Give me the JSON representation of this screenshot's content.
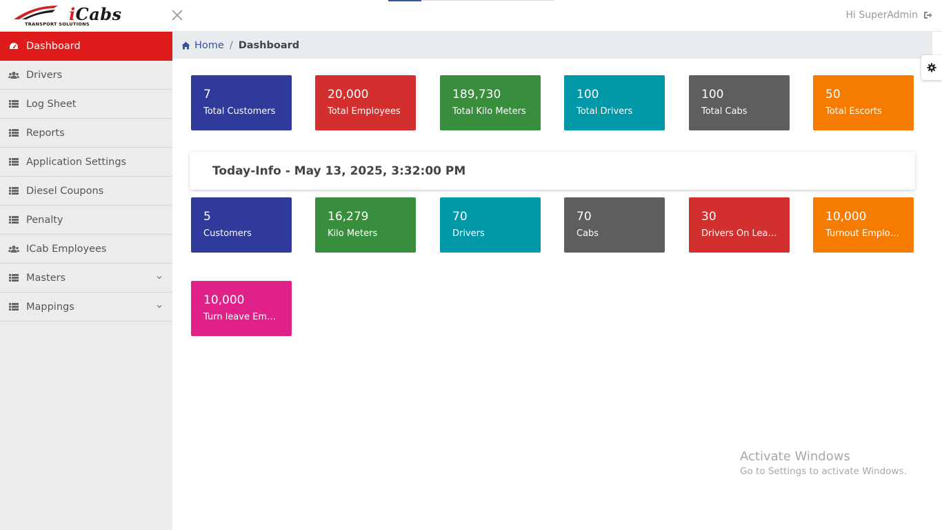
{
  "header": {
    "logo_text": "iCabs",
    "logo_tagline": "TRANSPORT SOLUTIONS",
    "greeting": "Hi SuperAdmin"
  },
  "sidebar": {
    "items": [
      {
        "label": "Dashboard",
        "icon": "dashboard-icon"
      },
      {
        "label": "Drivers",
        "icon": "users-icon"
      },
      {
        "label": "Log Sheet",
        "icon": "list-icon"
      },
      {
        "label": "Reports",
        "icon": "list-icon"
      },
      {
        "label": "Application Settings",
        "icon": "list-icon"
      },
      {
        "label": "Diesel Coupons",
        "icon": "list-icon"
      },
      {
        "label": "Penalty",
        "icon": "list-icon"
      },
      {
        "label": "ICab Employees",
        "icon": "users-icon"
      },
      {
        "label": "Masters",
        "icon": "list-icon"
      },
      {
        "label": "Mappings",
        "icon": "list-icon"
      }
    ]
  },
  "breadcrumb": {
    "home": "Home",
    "current": "Dashboard"
  },
  "totals": [
    {
      "value": "7",
      "label": "Total Customers",
      "color": "#2f3a9b"
    },
    {
      "value": "20,000",
      "label": "Total Employees",
      "color": "#d32f2f"
    },
    {
      "value": "189,730",
      "label": "Total Kilo Meters",
      "color": "#388e3c"
    },
    {
      "value": "100",
      "label": "Total Drivers",
      "color": "#0097a7"
    },
    {
      "value": "100",
      "label": "Total Cabs",
      "color": "#5e5e5e"
    },
    {
      "value": "50",
      "label": "Total Escorts",
      "color": "#f57c00"
    }
  ],
  "today": {
    "heading": "Today-Info - May 13, 2025, 3:32:00 PM",
    "tiles": [
      {
        "value": "5",
        "label": "Customers",
        "color": "#2f3a9b"
      },
      {
        "value": "16,279",
        "label": "Kilo Meters",
        "color": "#388e3c"
      },
      {
        "value": "70",
        "label": "Drivers",
        "color": "#0097a7"
      },
      {
        "value": "70",
        "label": "Cabs",
        "color": "#5e5e5e"
      },
      {
        "value": "30",
        "label": "Drivers On Leave",
        "color": "#d32f2f"
      },
      {
        "value": "10,000",
        "label": "Turnout Employees",
        "color": "#f57c00"
      },
      {
        "value": "10,000",
        "label": "Turn leave Employees",
        "color": "#e0218a"
      }
    ]
  },
  "watermark": {
    "line1": "Activate Windows",
    "line2": "Go to Settings to activate Windows."
  }
}
